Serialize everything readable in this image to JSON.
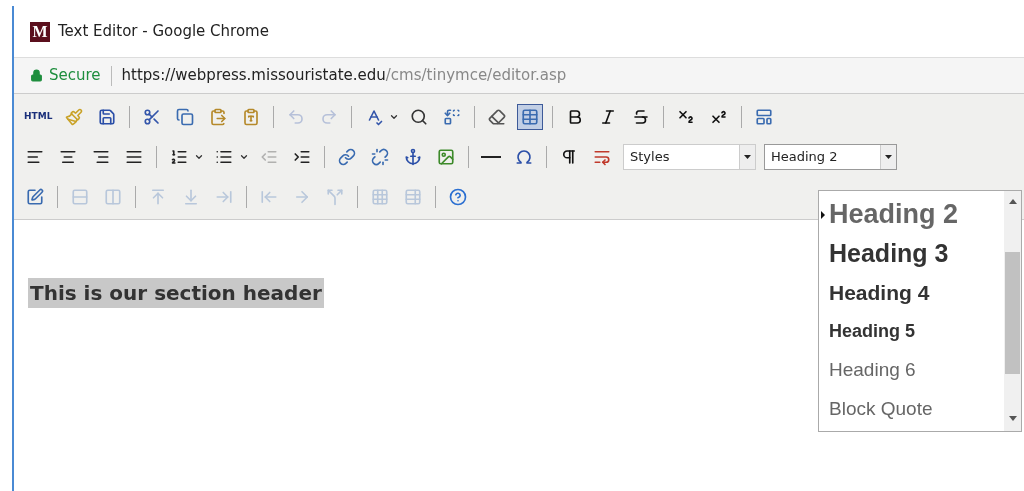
{
  "window": {
    "title": "Text Editor - Google Chrome",
    "logo": "M"
  },
  "address_bar": {
    "security": "Secure",
    "url_host": "https://webpress.missouristate.edu",
    "url_path": "/cms/tinymce/editor.asp"
  },
  "toolbar_rows": [
    [
      {
        "kind": "label",
        "text": "HTML"
      },
      {
        "kind": "button",
        "disabled": false,
        "active": false
      },
      {
        "kind": "button",
        "disabled": false,
        "active": false
      },
      {
        "kind": "separator"
      },
      {
        "kind": "button",
        "disabled": false,
        "active": false
      },
      {
        "kind": "button",
        "disabled": false,
        "active": false
      },
      {
        "kind": "button",
        "disabled": false,
        "active": false
      },
      {
        "kind": "button",
        "disabled": false,
        "active": false
      },
      {
        "kind": "separator"
      },
      {
        "kind": "button",
        "disabled": true,
        "active": false
      },
      {
        "kind": "button",
        "disabled": true,
        "active": false
      },
      {
        "kind": "separator"
      },
      {
        "kind": "button",
        "disabled": false,
        "active": false
      },
      {
        "kind": "caret"
      },
      {
        "kind": "button",
        "disabled": false,
        "active": false
      },
      {
        "kind": "button",
        "disabled": false,
        "active": false
      },
      {
        "kind": "separator"
      },
      {
        "kind": "button",
        "disabled": false,
        "active": false
      },
      {
        "kind": "button",
        "disabled": false,
        "active": true
      },
      {
        "kind": "separator"
      },
      {
        "kind": "button",
        "disabled": false,
        "active": false
      },
      {
        "kind": "button",
        "disabled": false,
        "active": false
      },
      {
        "kind": "button",
        "disabled": false,
        "active": false
      },
      {
        "kind": "separator"
      },
      {
        "kind": "button",
        "disabled": false,
        "active": false
      },
      {
        "kind": "button",
        "disabled": false,
        "active": false
      },
      {
        "kind": "separator"
      },
      {
        "kind": "button",
        "disabled": false,
        "active": false
      }
    ],
    [
      {
        "kind": "button",
        "disabled": false,
        "active": false
      },
      {
        "kind": "button",
        "disabled": false,
        "active": false
      },
      {
        "kind": "button",
        "disabled": false,
        "active": false
      },
      {
        "kind": "button",
        "disabled": false,
        "active": false
      },
      {
        "kind": "separator"
      },
      {
        "kind": "button",
        "disabled": false,
        "active": false
      },
      {
        "kind": "caret"
      },
      {
        "kind": "button",
        "disabled": false,
        "active": false
      },
      {
        "kind": "caret"
      },
      {
        "kind": "button",
        "disabled": true,
        "active": false
      },
      {
        "kind": "button",
        "disabled": false,
        "active": false
      },
      {
        "kind": "separator"
      },
      {
        "kind": "button",
        "disabled": false,
        "active": false
      },
      {
        "kind": "button",
        "disabled": false,
        "active": false
      },
      {
        "kind": "button",
        "disabled": false,
        "active": false
      },
      {
        "kind": "button",
        "disabled": false,
        "active": false
      },
      {
        "kind": "separator"
      },
      {
        "kind": "button",
        "disabled": false,
        "active": false
      },
      {
        "kind": "button",
        "disabled": false,
        "active": false
      },
      {
        "kind": "separator"
      },
      {
        "kind": "button",
        "disabled": false,
        "active": false
      },
      {
        "kind": "button",
        "disabled": false,
        "active": false
      },
      {
        "kind": "select",
        "value": "Styles",
        "expanded": false
      },
      {
        "kind": "select",
        "value": "Heading 2",
        "expanded": true
      }
    ],
    [
      {
        "kind": "button",
        "disabled": false,
        "active": false
      },
      {
        "kind": "separator"
      },
      {
        "kind": "button",
        "disabled": true,
        "active": false
      },
      {
        "kind": "button",
        "disabled": true,
        "active": false
      },
      {
        "kind": "separator"
      },
      {
        "kind": "button",
        "disabled": true,
        "active": false
      },
      {
        "kind": "button",
        "disabled": true,
        "active": false
      },
      {
        "kind": "button",
        "disabled": true,
        "active": false
      },
      {
        "kind": "separator"
      },
      {
        "kind": "button",
        "disabled": true,
        "active": false
      },
      {
        "kind": "button",
        "disabled": true,
        "active": false
      },
      {
        "kind": "button",
        "disabled": true,
        "active": false
      },
      {
        "kind": "separator"
      },
      {
        "kind": "button",
        "disabled": true,
        "active": false
      },
      {
        "kind": "button",
        "disabled": true,
        "active": false
      },
      {
        "kind": "separator"
      },
      {
        "kind": "button",
        "disabled": false,
        "active": false
      }
    ]
  ],
  "content": {
    "text": "This is our section header",
    "highlighted": true
  },
  "format_menu": [
    {
      "label": "Heading 2",
      "selected": true
    },
    {
      "label": "Heading 3",
      "selected": false
    },
    {
      "label": "Heading 4",
      "selected": false
    },
    {
      "label": "Heading 5",
      "selected": false
    },
    {
      "label": "Heading 6",
      "selected": false
    },
    {
      "label": "Block Quote",
      "selected": false
    }
  ]
}
